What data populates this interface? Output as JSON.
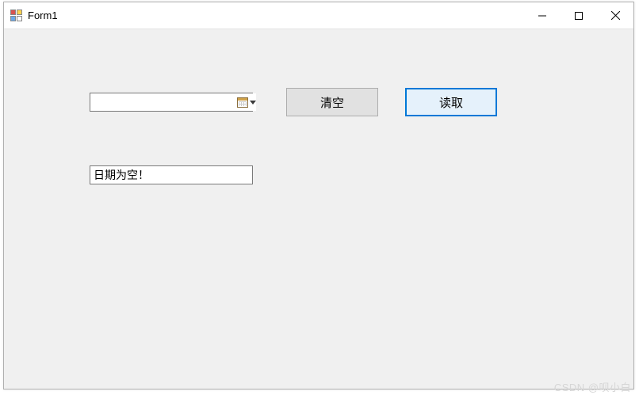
{
  "window": {
    "title": "Form1"
  },
  "form": {
    "datepicker": {
      "value": "",
      "placeholder": ""
    },
    "buttons": {
      "clear_label": "清空",
      "read_label": "读取"
    },
    "output": {
      "value": "日期为空！"
    }
  },
  "watermark": "CSDN @呗小白"
}
